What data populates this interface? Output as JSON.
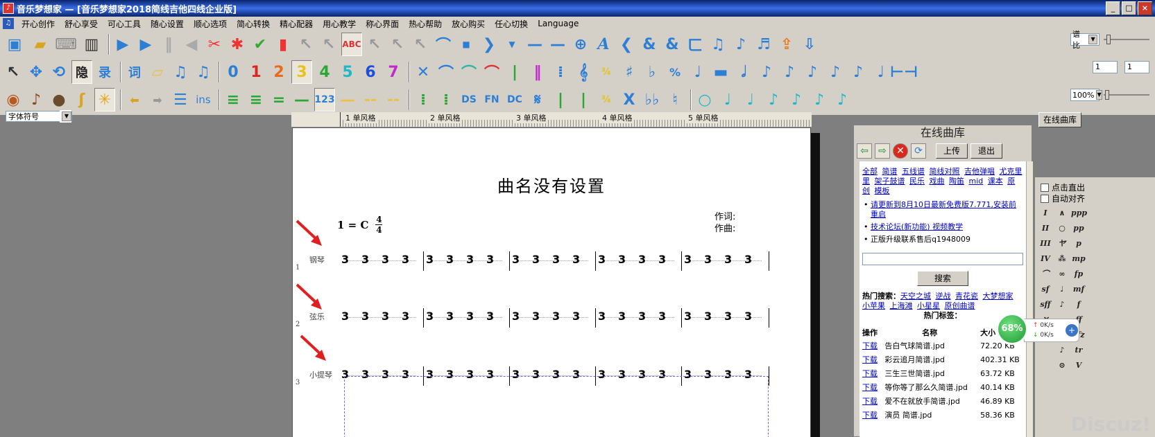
{
  "window": {
    "title": "音乐梦想家 — [音乐梦想家2018简线吉他四线企业版]",
    "minimize": "_",
    "maximize": "□",
    "close": "×"
  },
  "menu": [
    "开心创作",
    "舒心享受",
    "可心工具",
    "随心设置",
    "顺心选项",
    "简心转换",
    "精心配器",
    "用心教学",
    "称心界面",
    "热心帮助",
    "放心购买",
    "任心切换",
    "Language"
  ],
  "toolbar": {
    "row1_right": {
      "ratio_label": "谱比"
    },
    "row2_right": {
      "value_a": "1",
      "value_b": "1"
    },
    "row3_right": {
      "zoom": "100%"
    },
    "numbers": [
      "0",
      "1",
      "2",
      "3",
      "4",
      "5",
      "6",
      "7"
    ],
    "text_tools": [
      "隐",
      "录",
      "词"
    ],
    "row3_text": [
      "ins",
      "123",
      "DS",
      "FN",
      "DC"
    ]
  },
  "font_symbol": "字体符号",
  "ruler": {
    "labels": [
      "1 单风格",
      "2 单风格",
      "3 单风格",
      "4 单风格",
      "5 单风格"
    ]
  },
  "score": {
    "title": "曲名没有设置",
    "key": "1 = C",
    "time_top": "4",
    "time_bottom": "4",
    "lyricist_label": "作词:",
    "composer_label": "作曲:",
    "staves": [
      {
        "index": "1",
        "instrument": "钢琴"
      },
      {
        "index": "2",
        "instrument": "弦乐"
      },
      {
        "index": "3",
        "instrument": "小提琴"
      }
    ],
    "note": "3"
  },
  "library": {
    "tab_label": "在线曲库",
    "header": "在线曲库",
    "upload": "上传",
    "exit": "退出",
    "categories": [
      "全部",
      "简谱",
      "五线谱",
      "简线对照",
      "吉他弹唱",
      "尤克里里",
      "架子鼓谱",
      "民乐",
      "戏曲",
      "陶笛",
      "mid",
      "课本",
      "原创",
      "模板"
    ],
    "news": [
      {
        "text": "请更新到8月10日最新免费版7.771,安装前重启",
        "link": true
      },
      {
        "text": "技术论坛(新功能) 视频教学",
        "link": true
      },
      {
        "text": "正版升级联系售后q1948009",
        "link": false
      }
    ],
    "search_button": "搜索",
    "hot_search_label": "热门搜索：",
    "hot_searches": [
      "天空之城",
      "逆战",
      "青花瓷",
      "大梦想家",
      "小苹果",
      "上海滩",
      "小星星",
      "原创曲谱"
    ],
    "hot_tags_label": "热门标签：",
    "columns": {
      "action": "操作",
      "name": "名称",
      "size": "大小"
    },
    "files": [
      {
        "action": "下载",
        "name": "告白气球简谱.jpd",
        "size": "72.20 KB"
      },
      {
        "action": "下载",
        "name": "彩云追月简谱.jpd",
        "size": "402.31 KB"
      },
      {
        "action": "下载",
        "name": "三生三世简谱.jpd",
        "size": "63.72 KB"
      },
      {
        "action": "下载",
        "name": "等你等了那么久简谱.jpd",
        "size": "40.14 KB"
      },
      {
        "action": "下载",
        "name": "爱不在就放手简谱.jpd",
        "size": "46.89 KB"
      },
      {
        "action": "下载",
        "name": "演员 简谱.jpd",
        "size": "58.36 KB"
      }
    ]
  },
  "side_options": {
    "click_direct": "点击直出",
    "auto_align": "自动对齐"
  },
  "dynamics": [
    "I",
    "∧",
    "ppp",
    "II",
    "○",
    "pp",
    "III",
    "ヤ",
    "p",
    "IV",
    "⁂",
    "mp",
    "⌒",
    "∞",
    "fp",
    "sf",
    "♩",
    "mf",
    "sff",
    "♪",
    "f",
    "✕",
    "",
    "ff",
    "",
    "",
    "sfz",
    "",
    "♪",
    "tr",
    "",
    "⊙",
    "V"
  ],
  "network": {
    "percent": "68%",
    "up": "0K/s",
    "down": "0K/s",
    "plus": "+"
  },
  "watermark": "Discuz!",
  "colors": {
    "titlebar": "#0a246a",
    "accent_blue": "#2d7fd6",
    "link": "#0000cc"
  }
}
